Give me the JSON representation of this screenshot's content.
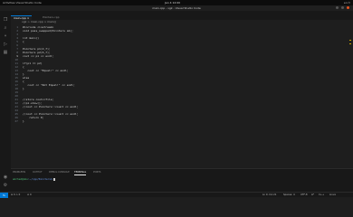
{
  "os_bar": {
    "left": "Activities   Visual Studio Code",
    "center": "Jan 4  12:00",
    "right": "en   ⏻"
  },
  "window": {
    "title": "main.cpp - vgk - Visual Studio Code"
  },
  "menu": [
    "File",
    "Edit",
    "Selection",
    "View",
    "Go",
    "Run",
    "Terminal",
    "Help"
  ],
  "tabs": [
    {
      "label": "main.cpp  ×",
      "active": true
    },
    {
      "label": "Pointers.cpp",
      "active": false
    }
  ],
  "breadcrumb": "vgk > main.cpp > main()",
  "code": {
    "current_line": 9,
    "lines": [
      {
        "n": "1",
        "text": "#include <iostream>"
      },
      {
        "n": "2",
        "text": "void pass_swapped(Pointers ab);"
      },
      {
        "n": "3",
        "text": ""
      },
      {
        "n": "4",
        "text": "int main()"
      },
      {
        "n": "5",
        "text": "{"
      },
      {
        "n": "6",
        "text": ""
      },
      {
        "n": "7",
        "text": "Pointers p1(2,7);"
      },
      {
        "n": "8",
        "text": "Pointers p2(6,7);"
      },
      {
        "n": "9",
        "text": "cout << p1 << endl;"
      },
      {
        "n": "10",
        "text": ""
      },
      {
        "n": "11",
        "text": "if(p1 == p2)"
      },
      {
        "n": "12",
        "text": "{"
      },
      {
        "n": "13",
        "text": "   cout << \"Equal!\" << endl;"
      },
      {
        "n": "14",
        "text": "}"
      },
      {
        "n": "15",
        "text": "else"
      },
      {
        "n": "16",
        "text": "{"
      },
      {
        "n": "17",
        "text": "   cout << \"Not Equal!\" << endl;"
      },
      {
        "n": "18",
        "text": "}"
      },
      {
        "n": "19",
        "text": ""
      },
      {
        "n": "20",
        "text": ""
      },
      {
        "n": "21",
        "text": "//store cout<<file;"
      },
      {
        "n": "22",
        "text": "//p1.show();"
      },
      {
        "n": "23",
        "text": "//cout << Pointers::count << endl;"
      },
      {
        "n": "24",
        "text": ""
      },
      {
        "n": "25",
        "text": "//cout << Pointers::count << endl;"
      },
      {
        "n": "26",
        "text": "    return 0;"
      },
      {
        "n": "27",
        "text": "}"
      }
    ]
  },
  "panel": {
    "tabs": [
      {
        "label": "PROBLEMS",
        "active": false
      },
      {
        "label": "OUTPUT",
        "active": false
      },
      {
        "label": "DEBUG CONSOLE",
        "active": false
      },
      {
        "label": "TERMINAL",
        "active": true
      },
      {
        "label": "PORTS",
        "active": false
      }
    ],
    "terminal": {
      "user": "amrhed@ubu",
      "path": ":~/cpp/Pointers$",
      "command": ""
    }
  },
  "status": {
    "left_items": [
      "⊗ 0  ⚠ 0",
      "⊘ 0"
    ],
    "right_items": [
      "Ln 9, Col 21",
      "Spaces: 4",
      "UTF-8",
      "LF",
      "C++",
      "Linux"
    ]
  }
}
